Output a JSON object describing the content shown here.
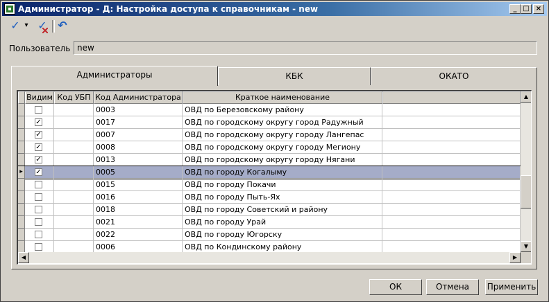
{
  "window": {
    "title": "Администратор - Д: Настройка доступа к справочникам - new",
    "min_glyph": "_",
    "max_glyph": "□",
    "close_glyph": "×"
  },
  "toolbar": {
    "apply_glyph": "✓",
    "dropdown_glyph": "▾",
    "clear_glyph": "✓",
    "undo_glyph": "↶"
  },
  "user": {
    "label": "Пользователь :",
    "value": "new"
  },
  "tabs": [
    {
      "label": "Администраторы",
      "active": true
    },
    {
      "label": "КБК",
      "active": false
    },
    {
      "label": "ОКАТО",
      "active": false
    }
  ],
  "grid": {
    "columns": [
      "Видим",
      "Код УБП",
      "Код Администратора",
      "Краткое наименование"
    ],
    "rows": [
      {
        "checked": false,
        "ubp": "",
        "code": "0003",
        "name": "ОВД по Березовскому району"
      },
      {
        "checked": true,
        "ubp": "",
        "code": "0017",
        "name": "ОВД по городскому округу город Радужный"
      },
      {
        "checked": true,
        "ubp": "",
        "code": "0007",
        "name": "ОВД по городскому округу городу Лангепас"
      },
      {
        "checked": true,
        "ubp": "",
        "code": "0008",
        "name": "ОВД по городскому округу городу Мегиону"
      },
      {
        "checked": true,
        "ubp": "",
        "code": "0013",
        "name": "ОВД по городскому округу городу Нягани"
      },
      {
        "checked": true,
        "ubp": "",
        "code": "0005",
        "name": "ОВД по городу Когалыму",
        "selected": true
      },
      {
        "checked": false,
        "ubp": "",
        "code": "0015",
        "name": "ОВД по городу Покачи"
      },
      {
        "checked": false,
        "ubp": "",
        "code": "0016",
        "name": "ОВД по городу Пыть-Ях"
      },
      {
        "checked": false,
        "ubp": "",
        "code": "0018",
        "name": "ОВД по городу Советский и району"
      },
      {
        "checked": false,
        "ubp": "",
        "code": "0021",
        "name": "ОВД по городу Урай"
      },
      {
        "checked": false,
        "ubp": "",
        "code": "0022",
        "name": "ОВД по городу Югорску"
      },
      {
        "checked": false,
        "ubp": "",
        "code": "0006",
        "name": "ОВД по Кондинскому району"
      }
    ],
    "check_glyph": "✓",
    "row_pointer_glyph": "▸",
    "scroll_up_glyph": "▲",
    "scroll_down_glyph": "▼",
    "scroll_left_glyph": "◀",
    "scroll_right_glyph": "▶"
  },
  "buttons": {
    "ok": "ОК",
    "cancel": "Отмена",
    "apply": "Применить"
  },
  "colors": {
    "selected_row": "#a5acc8",
    "check_blue": "#1f5fbf",
    "clear_red": "#c0282c"
  }
}
